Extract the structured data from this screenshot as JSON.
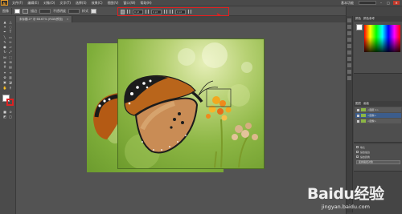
{
  "app": {
    "logo_text": "Ai"
  },
  "menubar": {
    "items": [
      "文件(F)",
      "编辑(E)",
      "对象(O)",
      "文字(T)",
      "选择(S)",
      "效果(C)",
      "视图(V)",
      "窗口(W)",
      "帮助(H)"
    ],
    "workspace_label": "基本功能"
  },
  "controlbar": {
    "selection_label": "图像",
    "stroke_label": "描边",
    "opacity_label": "不透明度",
    "style_label": "样式",
    "align_values": [
      "0 pt",
      "0 pt",
      "0 pt"
    ]
  },
  "document": {
    "tab_label": "未标题-1* @ 66.67% (RGB/预览)",
    "close_glyph": "×"
  },
  "panels": {
    "color_tabs": [
      "颜色",
      "颜色参考"
    ],
    "layers_tabs": [
      "图层",
      "画板"
    ],
    "layer_names": [
      "<图层 1>",
      "<图像>",
      "<图像>"
    ],
    "properties_labels": [
      "等比",
      "缩放描边",
      "缩放圆角"
    ],
    "properties_button": "变换路径对象"
  },
  "watermark": {
    "logo_text": "Baidu经验",
    "url_text": "jingyan.baidu.com"
  },
  "colors": {
    "annotation_red": "#e02020",
    "app_bg": "#535353",
    "brand_orange": "#e49a2b"
  }
}
